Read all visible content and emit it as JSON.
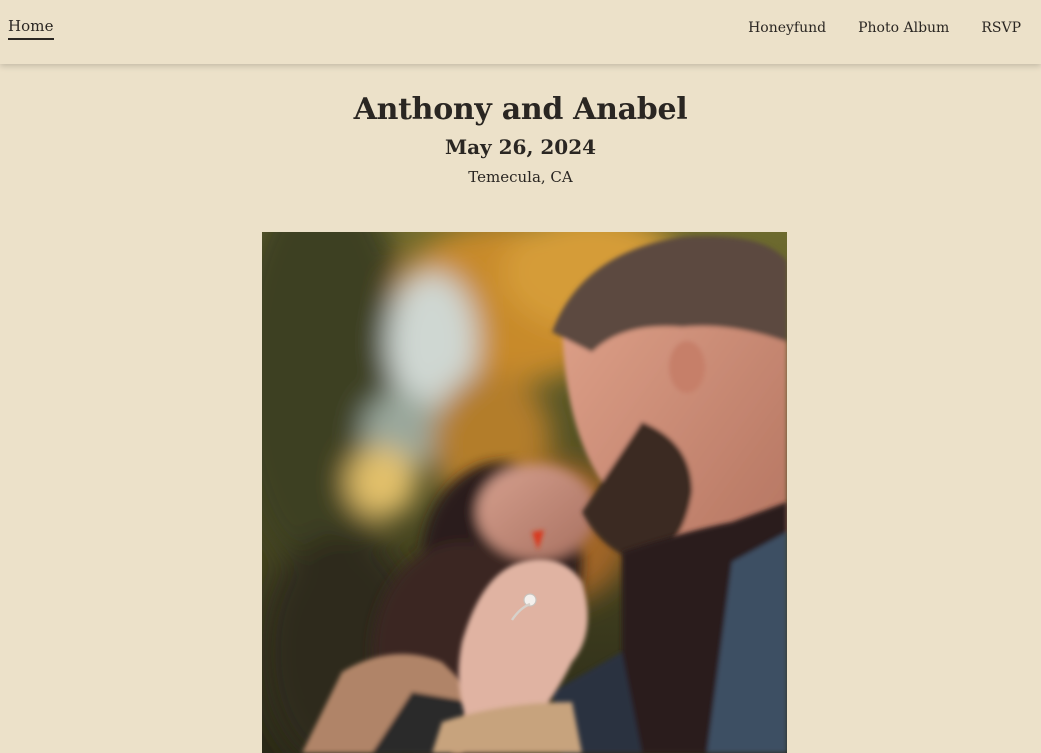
{
  "nav": {
    "home_label": "Home",
    "links": [
      "Honeyfund",
      "Photo Album",
      "RSVP"
    ]
  },
  "header": {
    "title": "Anthony and Anabel",
    "date": "May 26, 2024",
    "location": "Temecula, CA"
  },
  "colors": {
    "background": "#ece1c9",
    "text": "#2a2622"
  },
  "photo": {
    "icon": "engagement-photo"
  }
}
